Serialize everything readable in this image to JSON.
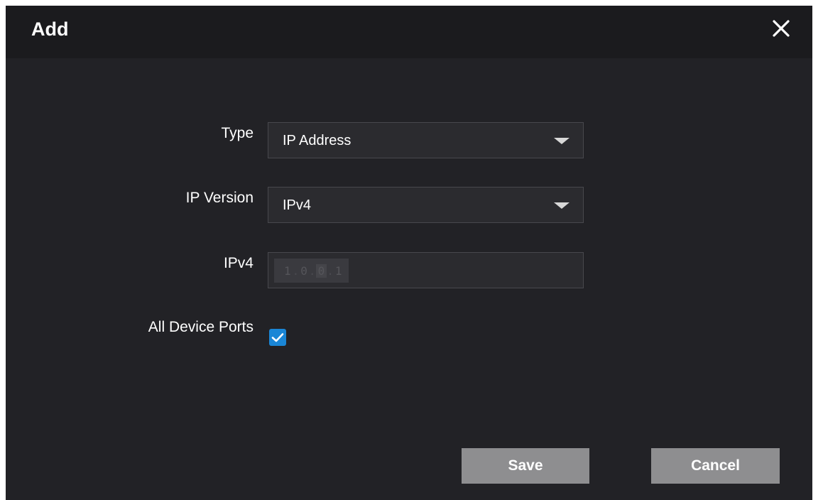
{
  "dialog": {
    "title": "Add",
    "close_icon": "close-icon"
  },
  "form": {
    "type": {
      "label": "Type",
      "value": "IP Address"
    },
    "ip_version": {
      "label": "IP Version",
      "value": "IPv4"
    },
    "ipv4": {
      "label": "IPv4",
      "octets": [
        "1",
        "0",
        "0",
        "1"
      ]
    },
    "all_device_ports": {
      "label": "All Device Ports",
      "checked": true
    }
  },
  "buttons": {
    "save_label": "Save",
    "cancel_label": "Cancel"
  },
  "colors": {
    "background": "#222226",
    "header": "#1b1b1e",
    "checkbox_accent": "#1a86d6",
    "button": "#8e8e90"
  }
}
